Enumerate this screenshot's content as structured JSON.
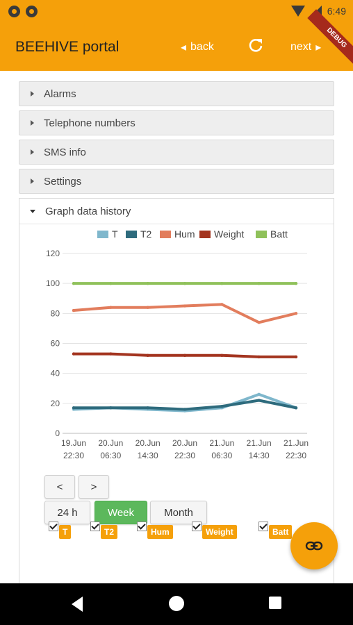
{
  "status": {
    "time": "6:49"
  },
  "appbar": {
    "title": "BEEHIVE portal",
    "back_label": "back",
    "next_label": "next",
    "debug_label": "DEBUG",
    "brand_color": "#f5a00a"
  },
  "panels": [
    {
      "label": "Alarms"
    },
    {
      "label": "Telephone numbers"
    },
    {
      "label": "SMS info"
    },
    {
      "label": "Settings"
    }
  ],
  "graph_panel": {
    "label": "Graph data history"
  },
  "chart_data": {
    "type": "line",
    "ylim": [
      0,
      120
    ],
    "y_ticks": [
      0,
      20,
      40,
      60,
      80,
      100,
      120
    ],
    "x": [
      [
        "19.Jun",
        "22:30"
      ],
      [
        "20.Jun",
        "06:30"
      ],
      [
        "20.Jun",
        "14:30"
      ],
      [
        "20.Jun",
        "22:30"
      ],
      [
        "21.Jun",
        "06:30"
      ],
      [
        "21.Jun",
        "14:30"
      ],
      [
        "21.Jun",
        "22:30"
      ]
    ],
    "legend_position": "top",
    "grid": true,
    "series": [
      {
        "name": "T",
        "color": "#7fb7cc",
        "values": [
          16,
          17,
          16,
          15,
          17,
          26,
          17
        ]
      },
      {
        "name": "T2",
        "color": "#2e6b7d",
        "values": [
          17,
          17,
          17,
          16,
          18,
          22,
          17
        ]
      },
      {
        "name": "Hum",
        "color": "#e27d5d",
        "values": [
          82,
          84,
          84,
          85,
          86,
          74,
          80
        ]
      },
      {
        "name": "Weight",
        "color": "#a3341f",
        "values": [
          53,
          53,
          52,
          52,
          52,
          51,
          51
        ]
      },
      {
        "name": "Batt",
        "color": "#8fc15a",
        "values": [
          100,
          100,
          100,
          100,
          100,
          100,
          100
        ]
      }
    ]
  },
  "controls": {
    "prev_label": "<",
    "next_label": ">",
    "ranges": [
      "24 h",
      "Week",
      "Month"
    ],
    "active_range": "Week"
  },
  "toggles": [
    "T",
    "T2",
    "Hum",
    "Weight",
    "Batt"
  ]
}
